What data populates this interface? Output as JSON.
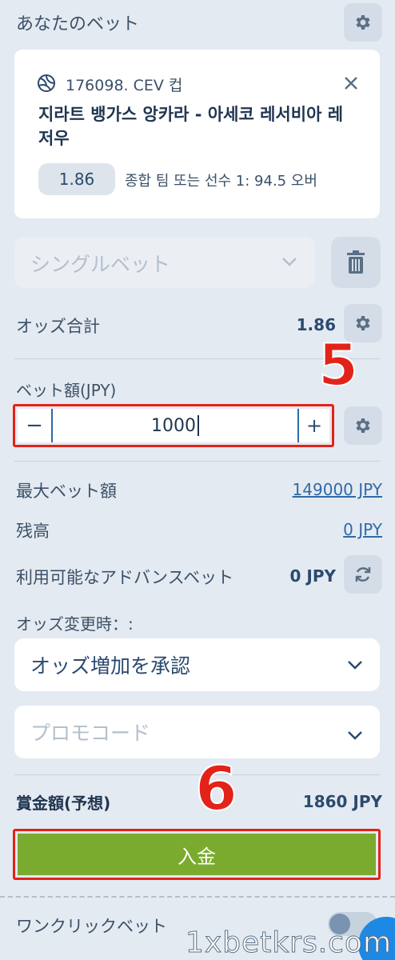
{
  "header": {
    "title": "あなたのベット"
  },
  "bet_card": {
    "league": "176098. CEV 컵",
    "match": "지라트 뱅가스 앙카라 - 아세코 레서비아 레저우",
    "odds": "1.86",
    "selection": "종합 팀 또는 선수 1: 94.5 오버"
  },
  "bet_type": {
    "placeholder": "シングルベット"
  },
  "odds_total": {
    "label": "オッズ合計",
    "value": "1.86"
  },
  "stake": {
    "label": "ベット額(JPY)",
    "minus": "−",
    "value": "1000",
    "plus": "+"
  },
  "max_bet": {
    "label": "最大ベット額",
    "value": "149000 JPY"
  },
  "balance": {
    "label": "残高",
    "value": "0 JPY"
  },
  "advance": {
    "label": "利用可能なアドバンスベット",
    "value": "0 JPY"
  },
  "odds_change": {
    "label": "オッズ変更時：:",
    "selected": "オッズ増加を承認"
  },
  "promo": {
    "placeholder": "プロモコード"
  },
  "winnings": {
    "label": "賞金額(予想)",
    "value": "1860 JPY"
  },
  "deposit_button": {
    "label": "入金"
  },
  "one_click": {
    "label": "ワンクリックベット"
  },
  "annotations": {
    "step5": "5",
    "step6": "6"
  },
  "watermark": "1xbetkrs.com",
  "colors": {
    "accent_red": "#e2231a",
    "button_green": "#7aab2e",
    "link_blue": "#2f6aa8"
  }
}
